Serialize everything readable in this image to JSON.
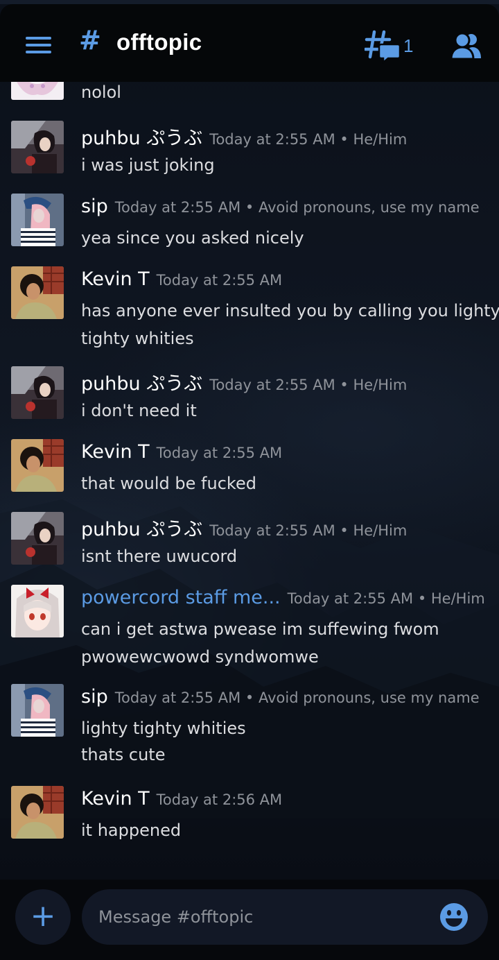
{
  "header": {
    "menu_icon": "hamburger-menu-icon",
    "channel_hash": "#",
    "channel_name": "offtopic",
    "threads_count": "1",
    "threads_icon": "threads-icon",
    "members_icon": "members-icon"
  },
  "messages": [
    {
      "author": "",
      "timestamp": "",
      "pronouns": "",
      "lines": [
        "nolol"
      ]
    },
    {
      "author": "puhbu ぷうぶ",
      "timestamp": "Today at 2:55 AM",
      "pronouns": "He/Him",
      "lines": [
        "i was just joking"
      ]
    },
    {
      "author": "sip",
      "timestamp": "Today at 2:55 AM",
      "pronouns": "Avoid pronouns, use my name",
      "lines": [
        "yea since you asked nicely"
      ]
    },
    {
      "author": "Kevin T",
      "timestamp": "Today at 2:55 AM",
      "pronouns": "",
      "lines": [
        "has anyone ever insulted you by calling you lighty",
        "tighty whities"
      ]
    },
    {
      "author": "puhbu ぷうぶ",
      "timestamp": "Today at 2:55 AM",
      "pronouns": "He/Him",
      "lines": [
        "i don't need it"
      ]
    },
    {
      "author": "Kevin T",
      "timestamp": "Today at 2:55 AM",
      "pronouns": "",
      "lines": [
        "that would be fucked"
      ]
    },
    {
      "author": "puhbu ぷうぶ",
      "timestamp": "Today at 2:55 AM",
      "pronouns": "He/Him",
      "lines": [
        "isnt there uwucord"
      ]
    },
    {
      "author": "powercord staff me...",
      "timestamp": "Today at 2:55 AM",
      "pronouns": "He/Him",
      "lines": [
        "can i get astwa pwease im suffewing fwom",
        "pwowewcwowd syndwomwe"
      ]
    },
    {
      "author": "sip",
      "timestamp": "Today at 2:55 AM",
      "pronouns": "Avoid pronouns, use my name",
      "lines": [
        "lighty tighty whities",
        "thats cute"
      ]
    },
    {
      "author": "Kevin T",
      "timestamp": "Today at 2:56 AM",
      "pronouns": "",
      "lines": [
        "it happened"
      ]
    }
  ],
  "composer": {
    "plus_label": "+",
    "placeholder": "Message #offtopic",
    "emoji_icon": "emoji-smile-icon"
  },
  "colors": {
    "accent": "#5b9be4",
    "header_bg": "#050709",
    "muted": "#8f939a",
    "text": "#dcdde0"
  }
}
